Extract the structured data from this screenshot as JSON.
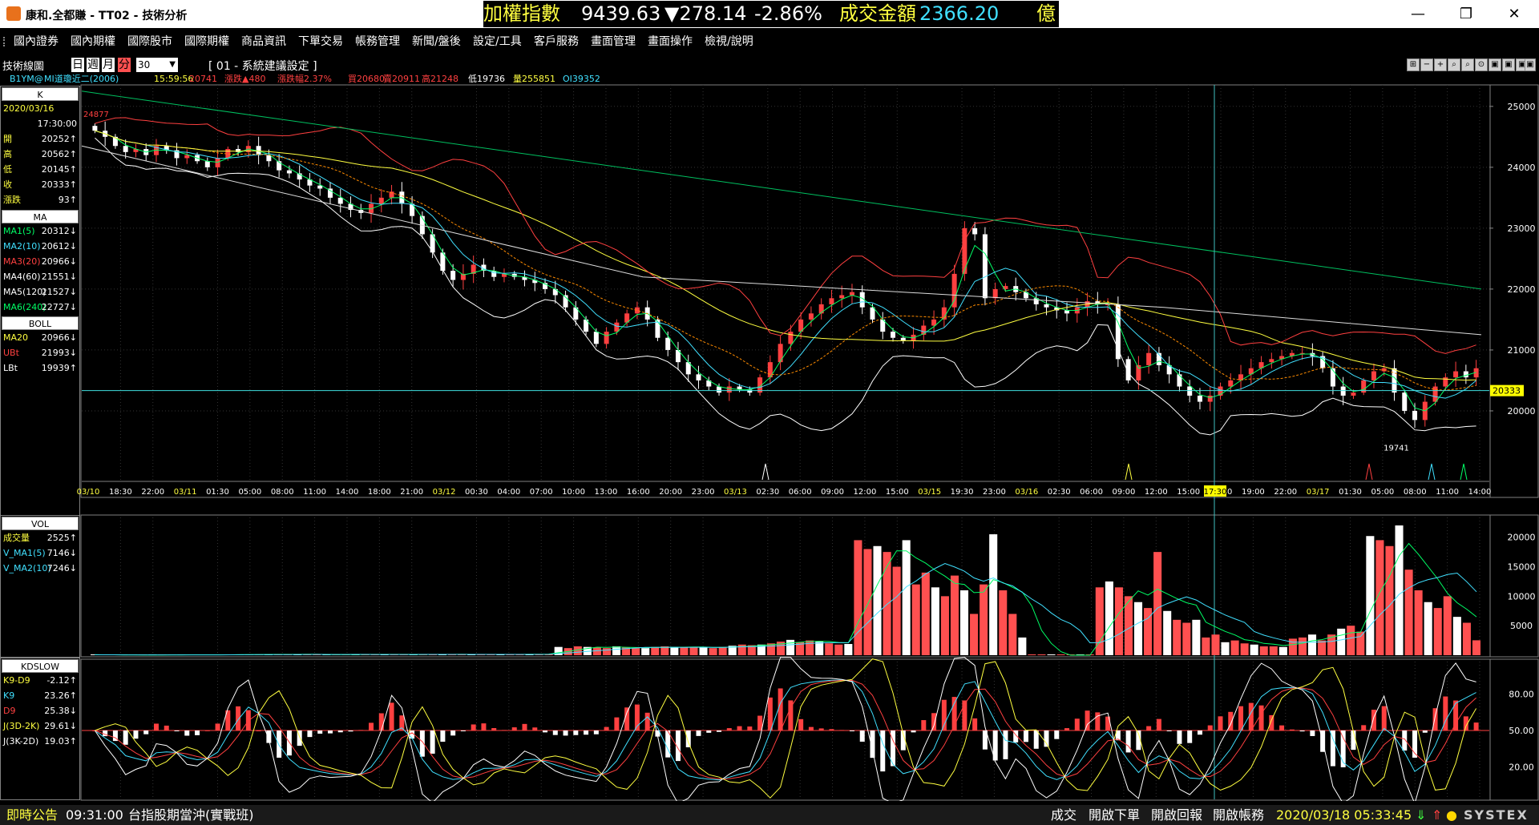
{
  "window": {
    "title": "康和.全都賺 - TT02 - 技術分析",
    "minimize": "—",
    "maximize": "❐",
    "close": "✕"
  },
  "ticker": {
    "label": "加權指數",
    "value": "9439.63",
    "change": "▼278.14",
    "percent": "-2.86%",
    "amount_label": "成交金額",
    "amount": "2366.20",
    "unit": "億"
  },
  "menu": [
    "國內證券",
    "國內期權",
    "國際股市",
    "國際期權",
    "商品資訊",
    "下單交易",
    "帳務管理",
    "新聞/盤後",
    "設定/工具",
    "客戶服務",
    "畫面管理",
    "畫面操作",
    "檢視/說明"
  ],
  "toolbar": {
    "label": "技術線圖",
    "periods": [
      "日",
      "週",
      "月",
      "分"
    ],
    "active_period": "分",
    "interval": "30",
    "setting": "[ 01 - 系統建議設定 ]",
    "buttons": [
      "⊞",
      "−",
      "+",
      "⌕",
      "⌕",
      "⊙",
      "▣",
      "▣",
      "▣",
      "▣"
    ]
  },
  "infobar": {
    "symbol": "B1YM@",
    "name": "MI道瓊近二(2006)",
    "time": "15:59:56",
    "price": "20741",
    "change": "漲跌▲480",
    "change_pct": "漲跌幅2.37%",
    "bid": "買20680",
    "ask": "賣20911",
    "high": "高21248",
    "low": "低19736",
    "volume": "量255851",
    "oi": "OI39352"
  },
  "panels": {
    "k": {
      "header": "K",
      "rows": [
        {
          "k": "2020/03/16",
          "v": ""
        },
        {
          "k": "",
          "v": "17:30:00"
        },
        {
          "k": "開",
          "v": "20252↑"
        },
        {
          "k": "高",
          "v": "20562↑"
        },
        {
          "k": "低",
          "v": "20145↑"
        },
        {
          "k": "收",
          "v": "20333↑"
        },
        {
          "k": "漲跌",
          "v": "93↑"
        }
      ]
    },
    "ma": {
      "header": "MA",
      "rows": [
        {
          "k": "MA1(5)",
          "v": "20312↓",
          "c": "#00ff66"
        },
        {
          "k": "MA2(10)",
          "v": "20612↓",
          "c": "#40e0ff"
        },
        {
          "k": "MA3(20)",
          "v": "20966↓",
          "c": "#ff4040"
        },
        {
          "k": "MA4(60)",
          "v": "21551↓",
          "c": "#ffffff"
        },
        {
          "k": "MA5(120)",
          "v": "21527↓",
          "c": "#ffffff"
        },
        {
          "k": "MA6(240)",
          "v": "22727↓",
          "c": "#00ff66"
        }
      ]
    },
    "boll": {
      "header": "BOLL",
      "rows": [
        {
          "k": "MA20",
          "v": "20966↓",
          "c": "#ffff40"
        },
        {
          "k": "UBt",
          "v": "21993↓",
          "c": "#ff4040"
        },
        {
          "k": "LBt",
          "v": "19939↑",
          "c": "#ffffff"
        }
      ]
    },
    "vol": {
      "header": "VOL",
      "rows": [
        {
          "k": "成交量",
          "v": "2525↑",
          "c": "#ffff40"
        },
        {
          "k": "V_MA1(5)",
          "v": "7146↓",
          "c": "#40e0ff"
        },
        {
          "k": "V_MA2(10)",
          "v": "7246↓",
          "c": "#40e0ff"
        }
      ]
    },
    "kd": {
      "header": "KDSLOW",
      "rows": [
        {
          "k": "K9-D9",
          "v": "-2.12↑",
          "c": "#ffff40"
        },
        {
          "k": "K9",
          "v": "23.26↑",
          "c": "#40e0ff"
        },
        {
          "k": "D9",
          "v": "25.38↓",
          "c": "#ff4040"
        },
        {
          "k": "J(3D-2K)",
          "v": "29.61↓",
          "c": "#ffff40"
        },
        {
          "k": "J(3K-2D)",
          "v": "19.03↑",
          "c": "#ffffff"
        }
      ]
    }
  },
  "chart_data": {
    "type": "candlestick",
    "price_axis": [
      25000,
      24000,
      23000,
      22000,
      21000,
      20000
    ],
    "ylim": [
      19000,
      25300
    ],
    "last_price": "20333",
    "high_label": "24877",
    "low_label": "19741",
    "time_labels": [
      "03/10",
      "18:30",
      "22:00",
      "03/11",
      "01:30",
      "05:00",
      "08:00",
      "11:00",
      "14:00",
      "18:00",
      "21:00",
      "03/12",
      "00:30",
      "04:00",
      "07:00",
      "10:00",
      "13:00",
      "16:00",
      "20:00",
      "23:00",
      "03/13",
      "02:30",
      "06:00",
      "09:00",
      "12:00",
      "15:00",
      "03/15",
      "19:30",
      "23:00",
      "03/16",
      "02:30",
      "06:00",
      "09:00",
      "12:00",
      "15:00",
      "17:30",
      "19:00",
      "22:00",
      "03/17",
      "01:30",
      "05:00",
      "08:00",
      "11:00",
      "14:00"
    ],
    "volume_axis": [
      20000,
      15000,
      10000,
      5000
    ],
    "kd_axis": [
      "80.00",
      "50.00",
      "20.00"
    ],
    "close": [
      24600,
      24500,
      24350,
      24250,
      24300,
      24200,
      24350,
      24280,
      24150,
      24200,
      24100,
      24000,
      24150,
      24300,
      24250,
      24350,
      24200,
      24100,
      23950,
      23900,
      23800,
      23700,
      23650,
      23500,
      23400,
      23300,
      23250,
      23400,
      23500,
      23600,
      23400,
      23200,
      22900,
      22600,
      22300,
      22150,
      22250,
      22400,
      22300,
      22200,
      22250,
      22200,
      22150,
      22100,
      22000,
      21900,
      21700,
      21500,
      21300,
      21100,
      21300,
      21450,
      21600,
      21700,
      21500,
      21200,
      21000,
      20800,
      20600,
      20500,
      20400,
      20300,
      20400,
      20350,
      20300,
      20550,
      20800,
      21100,
      21300,
      21500,
      21600,
      21750,
      21850,
      21900,
      21950,
      21700,
      21500,
      21300,
      21200,
      21150,
      21250,
      21400,
      21500,
      21700,
      22250,
      23000,
      22900,
      21850,
      22000,
      22050,
      21950,
      21850,
      21750,
      21700,
      21650,
      21600,
      21700,
      21800,
      21750,
      21750,
      20850,
      20500,
      20750,
      20950,
      20750,
      20600,
      20400,
      20250,
      20150,
      20250,
      20400,
      20500,
      20600,
      20700,
      20800,
      20850,
      20900,
      20950,
      20950,
      20900,
      20700,
      20400,
      20250,
      20300,
      20500,
      20650,
      20700,
      20300,
      20000,
      19850,
      20150,
      20400,
      20550,
      20650,
      20550,
      20700
    ],
    "volume": [
      80,
      60,
      50,
      40,
      40,
      30,
      40,
      60,
      70,
      90,
      80,
      70,
      60,
      60,
      100,
      130,
      140,
      90,
      120,
      200,
      150,
      120,
      150,
      100,
      80,
      100,
      130,
      150,
      160,
      120,
      130,
      140,
      110,
      120,
      140,
      150,
      150,
      130,
      150,
      110,
      120,
      140,
      130,
      150,
      160,
      160,
      170,
      190,
      1400,
      1200,
      1500,
      1400,
      1300,
      1200,
      1500,
      1300,
      1200,
      1200,
      1400,
      1500,
      1400,
      1300,
      1400,
      1300,
      1200,
      1400,
      1600,
      1800,
      1700,
      1800,
      2000,
      2300,
      2600,
      2200,
      2500,
      2300,
      2000,
      1800,
      1900,
      19500,
      18000,
      18500,
      17500,
      15000,
      19500,
      12000,
      14000,
      11500,
      10000,
      13500,
      11000,
      7000,
      12000,
      20500,
      11000,
      7000,
      3000,
      20,
      0,
      0,
      0,
      0,
      0,
      0,
      11500,
      12500,
      11500,
      10000,
      9000,
      8000,
      17500,
      7500,
      6000,
      5500,
      6000,
      3000,
      3500,
      2200,
      2500,
      2000,
      1800,
      1500,
      1500,
      1400,
      2800,
      3000,
      3500,
      2500,
      3500,
      4500,
      5000,
      4000,
      20200,
      19500,
      18500,
      22000,
      14500,
      11000,
      9000,
      8000,
      10000,
      6500,
      5500,
      2525
    ]
  },
  "status": {
    "label": "即時公告",
    "time": "09:31:00",
    "message": "台指股期當沖(實戰班)",
    "links": [
      "成交",
      "開啟下單",
      "開啟回報",
      "開啟帳務"
    ],
    "datetime": "2020/03/18 05:33:45",
    "brand": "SYSTEX"
  }
}
